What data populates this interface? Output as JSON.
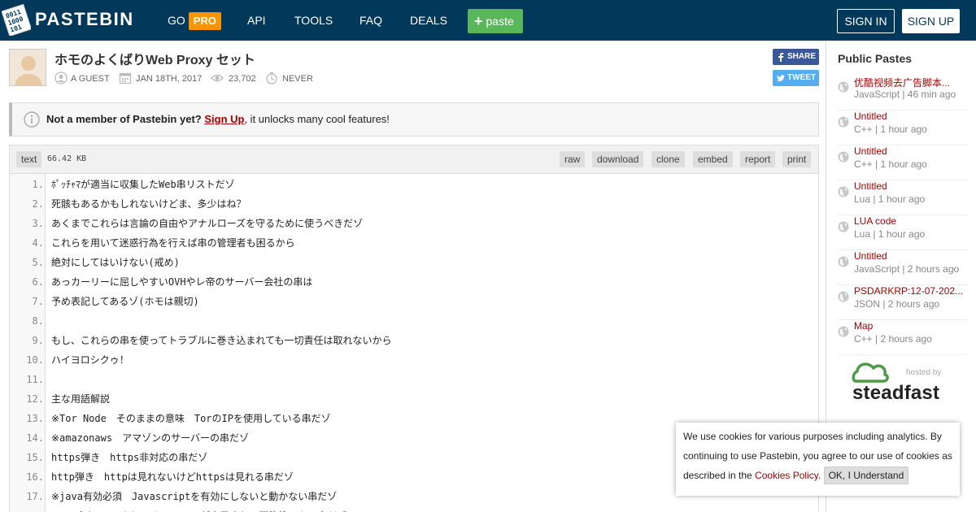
{
  "header": {
    "logo": "PASTEBIN",
    "nav": {
      "go": "GO",
      "pro": "PRO",
      "api": "API",
      "tools": "TOOLS",
      "faq": "FAQ",
      "deals": "DEALS"
    },
    "paste_button": "paste",
    "sign_in": "SIGN IN",
    "sign_up": "SIGN UP"
  },
  "paste": {
    "title": "ホモのよくばりWeb Proxy セット",
    "author": "A GUEST",
    "date": "JAN 18TH, 2017",
    "views": "23,702",
    "expire": "NEVER",
    "share": "SHARE",
    "tweet": "TWEET"
  },
  "notice": {
    "lead": "Not a member of Pastebin yet?",
    "link": "Sign Up",
    "tail": ", it unlocks many cool features!"
  },
  "code": {
    "syntax": "text",
    "size": "66.42 KB",
    "actions": [
      "raw",
      "download",
      "clone",
      "embed",
      "report",
      "print"
    ],
    "lines": [
      "ﾎﾟｯﾁｬﾏが適当に収集したWeb串リストだゾ",
      "死骸もあるかもしれないけどま、多少はね？",
      "あくまでこれらは言論の自由やアナルローズを守るために使うべきだゾ",
      "これらを用いて迷惑行為を行えば串の管理者も困るから",
      "絶対にしてはいけない(戒め)",
      "あっカーリーに屈しやすいOVHやレ帝のサーバー会社の串は",
      "予め表記してあるゾ(ホモは親切)",
      "",
      "もし、これらの串を使ってトラブルに巻き込まれても一切責任は取れないから",
      "ハイヨロシクゥ！",
      "",
      "主な用語解説",
      "※Tor Node　そのままの意味　TorのIPを使用している串だゾ",
      "※amazonaws　アマゾンのサーバーの串だゾ",
      "https弾き　https非対応の串だゾ",
      "http弾き　httpは見れないけどhttpsは見れる串だゾ",
      "※java有効必須　Javascriptを有効にしないと動かない串だゾ",
      "※CAS有り　Cookieのキャッシュが表示される可能性のある串だゾ"
    ]
  },
  "sidebar": {
    "title": "Public Pastes",
    "items": [
      {
        "name": "优酷视频去广告脚本...",
        "meta": "JavaScript | 46 min ago"
      },
      {
        "name": "Untitled",
        "meta": "C++ | 1 hour ago"
      },
      {
        "name": "Untitled",
        "meta": "C++ | 1 hour ago"
      },
      {
        "name": "Untitled",
        "meta": "Lua | 1 hour ago"
      },
      {
        "name": "LUA code",
        "meta": "Lua | 1 hour ago"
      },
      {
        "name": "Untitled",
        "meta": "JavaScript | 2 hours ago"
      },
      {
        "name": "PSDARKRP:12-07-202...",
        "meta": "JSON | 2 hours ago"
      },
      {
        "name": "Map",
        "meta": "C++ | 2 hours ago"
      }
    ],
    "sponsor_hosted": "hosted by",
    "sponsor_name": "steadfast"
  },
  "cookie": {
    "text": "We use cookies for various purposes including analytics. By continuing to use Pastebin, you agree to our use of cookies as described in the ",
    "link": "Cookies Policy",
    "after": ".",
    "button": "OK, I Understand"
  },
  "colors": {
    "header_bg": "#023859",
    "pro": "#f69401",
    "paste_btn": "#59b75a",
    "link_red": "#a70000"
  }
}
